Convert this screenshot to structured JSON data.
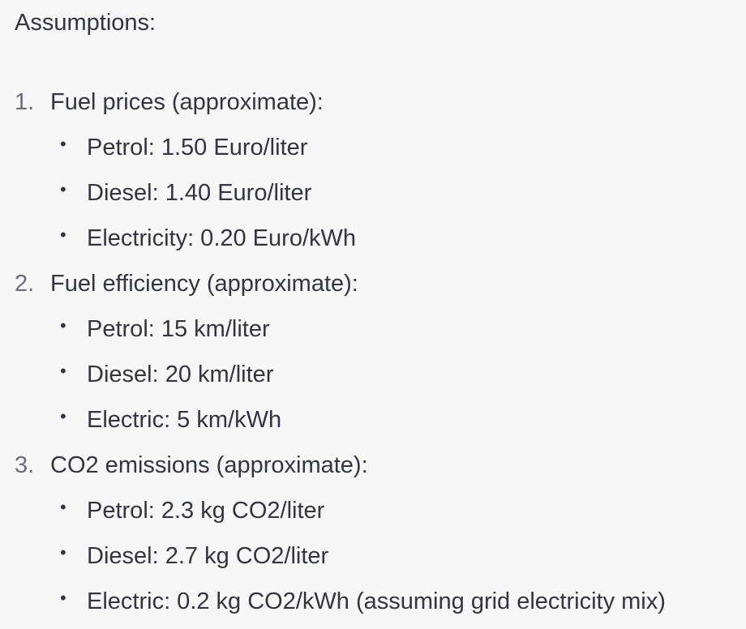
{
  "intro": "Assumptions:",
  "sections": [
    {
      "number": "1.",
      "title": "Fuel prices (approximate):",
      "items": [
        "Petrol: 1.50 Euro/liter",
        "Diesel: 1.40 Euro/liter",
        "Electricity: 0.20 Euro/kWh"
      ]
    },
    {
      "number": "2.",
      "title": "Fuel efficiency (approximate):",
      "items": [
        "Petrol: 15 km/liter",
        "Diesel: 20 km/liter",
        "Electric: 5 km/kWh"
      ]
    },
    {
      "number": "3.",
      "title": "CO2 emissions (approximate):",
      "items": [
        "Petrol: 2.3 kg CO2/liter",
        "Diesel: 2.7 kg CO2/liter",
        "Electric: 0.2 kg CO2/kWh (assuming grid electricity mix)"
      ]
    }
  ]
}
